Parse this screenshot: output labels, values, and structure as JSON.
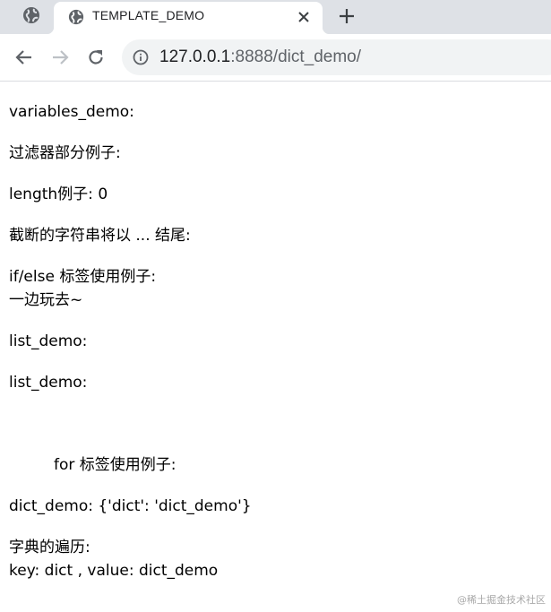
{
  "browser": {
    "tab": {
      "title": "TEMPLATE_DEMO",
      "favicon": "globe-icon"
    },
    "inactive_tab_icon": "globe-icon",
    "close_icon": "close-icon",
    "new_tab_icon": "plus-icon",
    "nav": {
      "back_icon": "back-arrow-icon",
      "forward_icon": "forward-arrow-icon",
      "reload_icon": "reload-icon",
      "info_icon": "info-icon"
    },
    "address": {
      "host": "127.0.0.1",
      "rest": ":8888/dict_demo/"
    }
  },
  "page": {
    "lines": [
      "variables_demo:",
      "过滤器部分例子:",
      "length例子: 0",
      "截断的字符串将以 ... 结尾:",
      "if/else 标签使用例子:",
      "一边玩去~",
      "list_demo:",
      "list_demo:",
      "for 标签使用例子:",
      "dict_demo: {'dict': 'dict_demo'}",
      "字典的遍历:",
      "key: dict , value: dict_demo"
    ]
  },
  "watermark": "@稀土掘金技术社区",
  "colors": {
    "tabstrip": "#dee1e6",
    "omnibox": "#f1f3f4",
    "text": "#000000",
    "icon": "#5f6368"
  }
}
